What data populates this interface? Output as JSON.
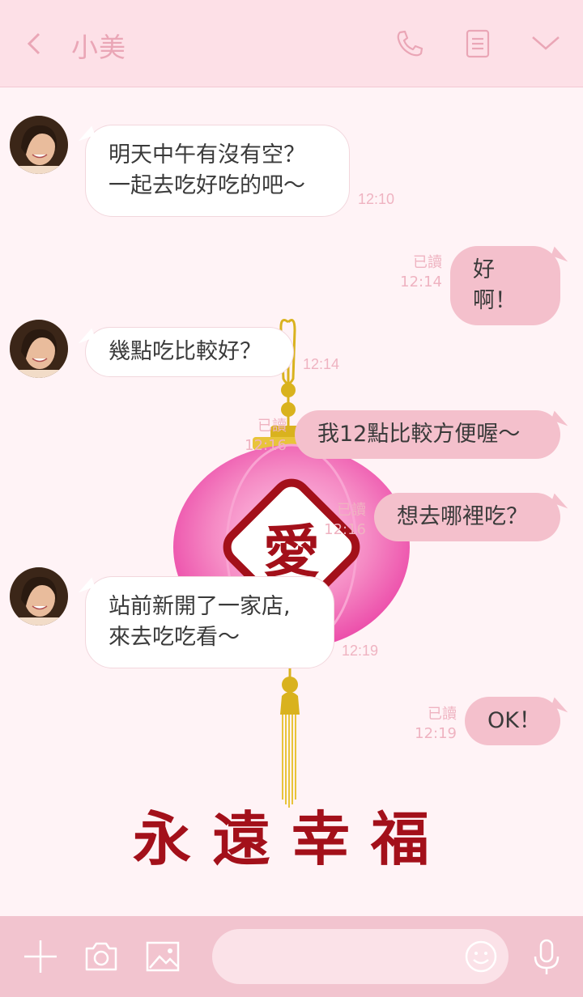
{
  "header": {
    "title": "小美",
    "back_icon": "chevron-left-icon",
    "call_icon": "phone-icon",
    "notes_icon": "document-icon",
    "menu_icon": "chevron-down-icon"
  },
  "messages": [
    {
      "from": "friend",
      "lines": [
        "明天中午有沒有空？",
        "一起去吃好吃的吧～"
      ],
      "time": "12:10"
    },
    {
      "from": "me",
      "text": "好啊！",
      "read": "已讀",
      "time": "12:14"
    },
    {
      "from": "friend",
      "lines": [
        "幾點吃比較好？"
      ],
      "time": "12:14"
    },
    {
      "from": "me",
      "text": "我12點比較方便喔～",
      "read": "已讀",
      "time": "12:16"
    },
    {
      "from": "me",
      "text": "想去哪裡吃？",
      "read": "已讀",
      "time": "12:16"
    },
    {
      "from": "friend",
      "lines": [
        "站前新開了一家店,",
        "來去吃吃看～"
      ],
      "time": "12:19"
    },
    {
      "from": "me",
      "text": "OK！",
      "read": "已讀",
      "time": "12:19"
    }
  ],
  "background": {
    "lantern_char": "愛",
    "caption": "永遠幸福",
    "colors": {
      "lantern": "#f06ab8",
      "gold": "#d9b21e",
      "red": "#a3101a"
    }
  },
  "footer": {
    "plus_icon": "plus-icon",
    "camera_icon": "camera-icon",
    "image_icon": "image-icon",
    "emoji_icon": "smiley-icon",
    "mic_icon": "microphone-icon",
    "input_placeholder": ""
  }
}
